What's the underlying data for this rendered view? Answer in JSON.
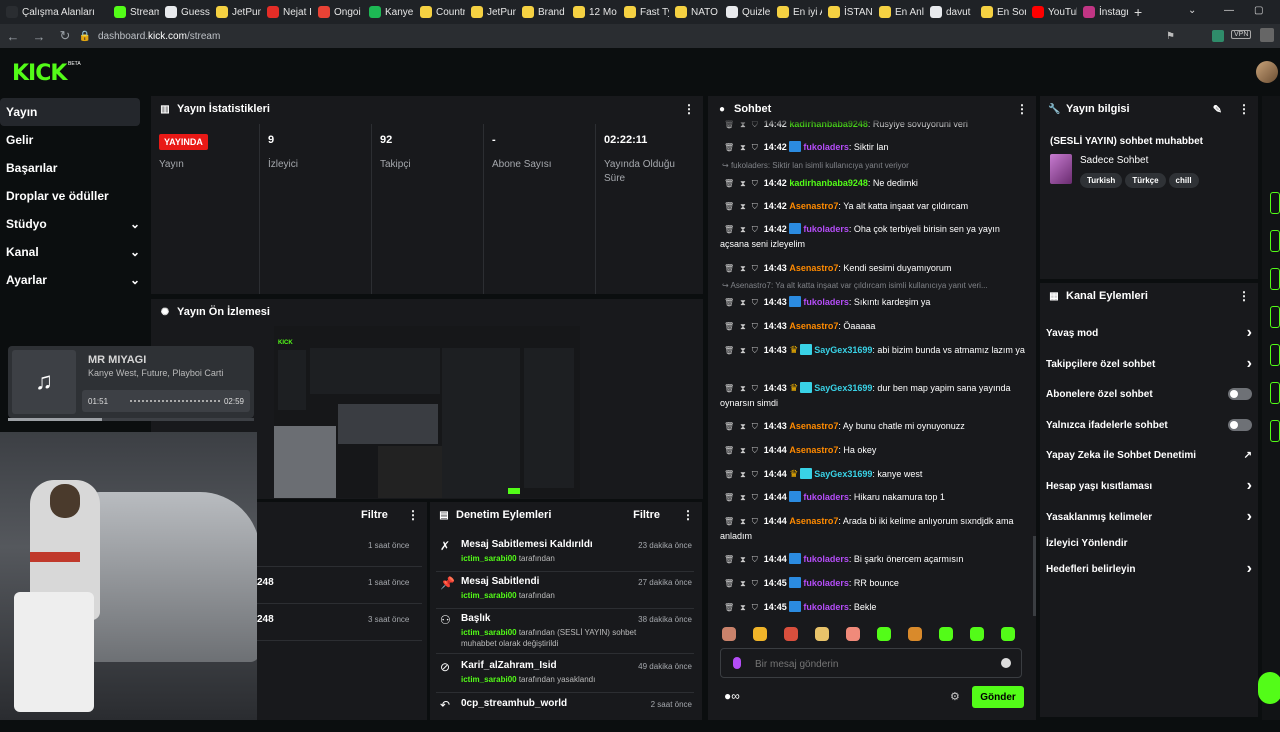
{
  "browser": {
    "tabs": [
      {
        "label": "Çalışma Alanları",
        "color": "#2a2d31"
      },
      {
        "label": "Stream",
        "color": "#53fc18"
      },
      {
        "label": "Guess",
        "color": "#e8eaed"
      },
      {
        "label": "JetPun",
        "color": "#f5d142"
      },
      {
        "label": "Nejat I",
        "color": "#e52d27"
      },
      {
        "label": "Ongoi",
        "color": "#e94235"
      },
      {
        "label": "Kanye",
        "color": "#1db954"
      },
      {
        "label": "Countr",
        "color": "#f5d142"
      },
      {
        "label": "JetPun",
        "color": "#f5d142"
      },
      {
        "label": "Brand",
        "color": "#f5d142"
      },
      {
        "label": "12 Mo",
        "color": "#f5d142"
      },
      {
        "label": "Fast Ty",
        "color": "#f5d142"
      },
      {
        "label": "NATO 1",
        "color": "#f5d142"
      },
      {
        "label": "Quizle",
        "color": "#e8eaed"
      },
      {
        "label": "En iyi A",
        "color": "#f5d142"
      },
      {
        "label": "İSTANE",
        "color": "#f5d142"
      },
      {
        "label": "En Anl",
        "color": "#f5d142"
      },
      {
        "label": "davut",
        "color": "#e8eaed"
      },
      {
        "label": "En Son",
        "color": "#f5d142"
      },
      {
        "label": "YouTub",
        "color": "#ff0000"
      },
      {
        "label": "İnstagr",
        "color": "#c13584"
      }
    ],
    "url_prefix": "dashboard.",
    "url_domain": "kick.com",
    "url_path": "/stream"
  },
  "header": {
    "logo": "KICK",
    "beta": "BETA"
  },
  "sidebar": {
    "items": [
      {
        "label": "Yayın",
        "chevron": false
      },
      {
        "label": "Gelir",
        "chevron": false
      },
      {
        "label": "Başarılar",
        "chevron": false
      },
      {
        "label": "Droplar ve ödüller",
        "chevron": false
      },
      {
        "label": "Stüdyo",
        "chevron": true
      },
      {
        "label": "Kanal",
        "chevron": true
      },
      {
        "label": "Ayarlar",
        "chevron": true
      }
    ]
  },
  "stats": {
    "title": "Yayın İstatistikleri",
    "live_badge": "YAYINDA",
    "items": [
      {
        "value": "",
        "label": "Yayın"
      },
      {
        "value": "9",
        "label": "İzleyici"
      },
      {
        "value": "92",
        "label": "Takipçi"
      },
      {
        "value": "-",
        "label": "Abone Sayısı"
      },
      {
        "value": "02:22:11",
        "label": "Yayında Olduğu Süre"
      }
    ]
  },
  "preview": {
    "title": "Yayın Ön İzlemesi"
  },
  "music": {
    "title": "MR MIYAGI",
    "artist": "Kanye West, Future, Playboi Carti",
    "elapsed": "01:51",
    "duration": "02:59",
    "progress": 0.62
  },
  "activity": {
    "filter": "Filtre",
    "rows": [
      {
        "value": "",
        "time": "1 saat önce"
      },
      {
        "value": "248",
        "time": "1 saat önce"
      },
      {
        "value": "248",
        "time": "3 saat önce"
      }
    ]
  },
  "mod": {
    "title": "Denetim Eylemleri",
    "filter": "Filtre",
    "rows": [
      {
        "icon": "unpin",
        "title": "Mesaj Sabitlemesi Kaldırıldı",
        "user": "ictim_sarabi00",
        "suffix": " tarafından",
        "time": "23 dakika önce"
      },
      {
        "icon": "pin",
        "title": "Mesaj Sabitlendi",
        "user": "ictim_sarabi00",
        "suffix": " tarafından",
        "time": "27 dakika önce"
      },
      {
        "icon": "title",
        "title": "Başlık",
        "user": "ictim_sarabi00",
        "suffix": " tarafından (SESLİ YAYIN) sohbet muhabbet olarak değiştirildi",
        "time": "38 dakika önce"
      },
      {
        "icon": "ban",
        "title": "Karif_alZahram_Isid",
        "user": "ictim_sarabi00",
        "suffix": " tarafından yasaklandı",
        "time": "49 dakika önce"
      },
      {
        "icon": "undo",
        "title": "0cp_streamhub_world",
        "user": "",
        "suffix": "",
        "time": "2 saat önce"
      }
    ]
  },
  "chat": {
    "title": "Sohbet",
    "input_placeholder": "Bir mesaj gönderin",
    "send": "Gönder",
    "messages": [
      {
        "time": "14:42",
        "user": "kadirhanbaba9248",
        "color": "#53fc18",
        "text": "Rusyiye sovuyoruni veri",
        "badges": ""
      },
      {
        "time": "14:42",
        "user": "fukoladers",
        "color": "#b44df7",
        "text": "Siktir lan",
        "badges": "bot"
      },
      {
        "reply": "fukoladers: Siktir lan isimli kullanıcıya yanıt veriyor"
      },
      {
        "time": "14:42",
        "user": "kadirhanbaba9248",
        "color": "#53fc18",
        "text": "Ne dedimki",
        "badges": ""
      },
      {
        "time": "14:42",
        "user": "Asenastro7",
        "color": "#ff8a00",
        "text": "Ya alt katta inşaat var çıldırcam",
        "badges": ""
      },
      {
        "time": "14:42",
        "user": "fukoladers",
        "color": "#b44df7",
        "text": "Oha çok terbiyeli birisin sen ya yayın açsana seni izleyelim",
        "badges": "bot"
      },
      {
        "time": "14:43",
        "user": "Asenastro7",
        "color": "#ff8a00",
        "text": "Kendi sesimi duyamıyorum",
        "badges": ""
      },
      {
        "reply": "Asenastro7: Ya alt katta inşaat var çıldırcam isimli kullanıcıya yanıt veri..."
      },
      {
        "time": "14:43",
        "user": "fukoladers",
        "color": "#b44df7",
        "text": "Sıkıntı kardeşim ya",
        "badges": "bot"
      },
      {
        "time": "14:43",
        "user": "Asenastro7",
        "color": "#ff8a00",
        "text": "Öaaaaa",
        "badges": ""
      },
      {
        "time": "14:43",
        "user": "SayGex31699",
        "color": "#39d2e6",
        "text": "abi bizim bunda vs atmamız lazım ya",
        "badges": "crown"
      },
      {
        "time": "14:43",
        "user": "SayGex31699",
        "color": "#39d2e6",
        "text": "dur ben map yapim sana yayında oynarsın simdi",
        "badges": "crown"
      },
      {
        "time": "14:43",
        "user": "Asenastro7",
        "color": "#ff8a00",
        "text": "Ay bunu chatle mi oynuyonuzz",
        "badges": ""
      },
      {
        "time": "14:44",
        "user": "Asenastro7",
        "color": "#ff8a00",
        "text": "Ha okey",
        "badges": ""
      },
      {
        "time": "14:44",
        "user": "SayGex31699",
        "color": "#39d2e6",
        "text": "kanye west",
        "badges": "crown"
      },
      {
        "time": "14:44",
        "user": "fukoladers",
        "color": "#b44df7",
        "text": "Hikaru nakamura top 1",
        "badges": "bot"
      },
      {
        "time": "14:44",
        "user": "Asenastro7",
        "color": "#ff8a00",
        "text": "Arada bi iki kelime anlıyorum sıxndjdk ama anladım",
        "badges": ""
      },
      {
        "time": "14:44",
        "user": "fukoladers",
        "color": "#b44df7",
        "text": "Bi şarkı önercem açarmısın",
        "badges": "bot"
      },
      {
        "time": "14:45",
        "user": "fukoladers",
        "color": "#b44df7",
        "text": "RR bounce",
        "badges": "bot"
      },
      {
        "time": "14:45",
        "user": "fukoladers",
        "color": "#b44df7",
        "text": "Bekle",
        "badges": "bot"
      }
    ]
  },
  "info": {
    "title": "Yayın bilgisi",
    "stream_title": "(SESLİ YAYIN) sohbet muhabbet",
    "category": "Sadece Sohbet",
    "tags": [
      "Turkish",
      "Türkçe",
      "chill"
    ]
  },
  "actions": {
    "title": "Kanal Eylemleri",
    "items": [
      {
        "label": "Yavaş mod",
        "kind": "chevron"
      },
      {
        "label": "Takipçilere özel sohbet",
        "kind": "chevron"
      },
      {
        "label": "Abonelere özel sohbet",
        "kind": "toggle"
      },
      {
        "label": "Yalnızca ifadelerle sohbet",
        "kind": "toggle"
      },
      {
        "label": "Yapay Zeka ile Sohbet Denetimi",
        "kind": "external"
      },
      {
        "label": "Hesap yaşı kısıtlaması",
        "kind": "chevron"
      },
      {
        "label": "Yasaklanmış kelimeler",
        "kind": "chevron"
      },
      {
        "label": "İzleyici Yönlendir",
        "kind": "none"
      },
      {
        "label": "Hedefleri belirleyin",
        "kind": "chevron"
      }
    ]
  },
  "colors": {
    "accent": "#53fc18",
    "live": "#e91916",
    "panel": "#18191c",
    "bg": "#0b0e0f"
  }
}
